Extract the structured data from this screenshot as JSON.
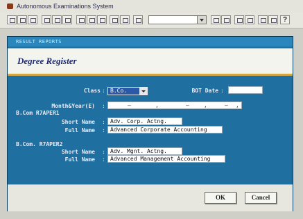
{
  "window": {
    "title": "Autonomous Examinations System"
  },
  "dialog": {
    "caption": "RESULT REPORTS",
    "heading": "Degree Register",
    "class_label": "Class",
    "class_value": "B.Co.",
    "bot_date_label": "BOT Date",
    "bot_date_value": "",
    "month_year_label": "Month&Year(E)",
    "month_year_values": [
      "",
      "",
      "",
      ""
    ],
    "paper1": {
      "header": "B.Com  R7APER1",
      "short_label": "Short Name",
      "short_value": "Adv. Corp. Actng.",
      "full_label": "Full Name",
      "full_value": "Advanced Corporate Accounting"
    },
    "paper2": {
      "header": "B.Com. R7APER2",
      "short_label": "Short Name",
      "short_value": "Adv. Mgnt. Actng.",
      "full_label": "Full Name",
      "full_value": "Advanced Management Accounting"
    },
    "ok_label": "OK",
    "cancel_label": "Cancel"
  },
  "icons": {
    "app": "app-logo-icon",
    "help": "help-icon",
    "dropdown": "chevron-down-icon"
  },
  "colors": {
    "dialog_bg": "#1f6fa1",
    "heading_text": "#1e2a78",
    "accent_line": "#d6a843"
  }
}
